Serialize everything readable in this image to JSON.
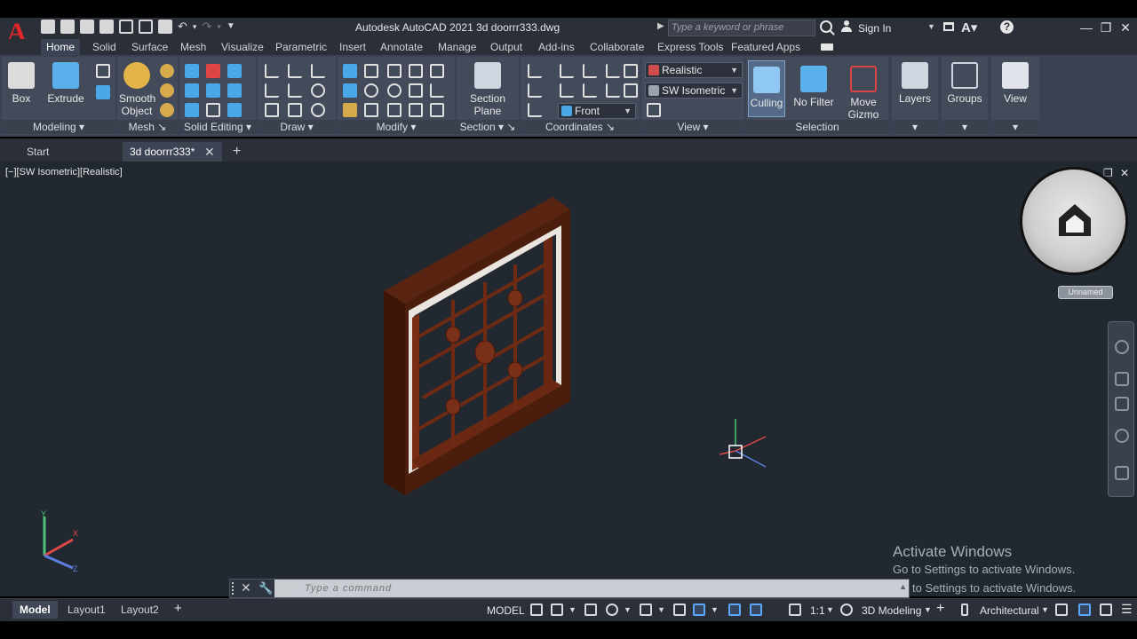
{
  "app": {
    "title": "Autodesk AutoCAD 2021   3d doorrr333.dwg",
    "logo": "A",
    "search_placeholder": "Type a keyword or phrase",
    "sign_in": "Sign In"
  },
  "ribbon_tabs": [
    "Home",
    "Solid",
    "Surface",
    "Mesh",
    "Visualize",
    "Parametric",
    "Insert",
    "Annotate",
    "Manage",
    "Output",
    "Add-ins",
    "Collaborate",
    "Express Tools",
    "Featured Apps"
  ],
  "ribbon": {
    "modeling": {
      "title": "Modeling",
      "box": "Box",
      "extrude": "Extrude"
    },
    "mesh": {
      "title": "Mesh",
      "smooth_object_1": "Smooth",
      "smooth_object_2": "Object"
    },
    "solid_editing": {
      "title": "Solid Editing"
    },
    "draw": {
      "title": "Draw"
    },
    "modify": {
      "title": "Modify"
    },
    "section": {
      "title": "Section",
      "section_plane_1": "Section",
      "section_plane_2": "Plane"
    },
    "coordinates": {
      "title": "Coordinates"
    },
    "view": {
      "title": "View",
      "visual_style": "Realistic",
      "view_preset": "SW Isometric",
      "viewport_view": "Front"
    },
    "selection": {
      "title": "Selection",
      "culling": "Culling",
      "no_filter": "No Filter",
      "move_gizmo_1": "Move",
      "move_gizmo_2": "Gizmo"
    },
    "layers": "Layers",
    "groups": "Groups",
    "view_big": "View"
  },
  "doc_tabs": {
    "start": "Start",
    "file": "3d doorrr333*"
  },
  "viewport": {
    "label": "[−][SW Isometric][Realistic]",
    "unnamed": "Unnamed"
  },
  "activation": {
    "title": "Activate Windows",
    "sub": "Go to Settings to activate Windows.",
    "sub2": "to Settings to activate Windows."
  },
  "command": {
    "placeholder": "Type a command"
  },
  "status": {
    "layouts": [
      "Model",
      "Layout1",
      "Layout2"
    ],
    "model": "MODEL",
    "scale": "1:1",
    "workspace": "3D Modeling",
    "units": "Architectural"
  }
}
